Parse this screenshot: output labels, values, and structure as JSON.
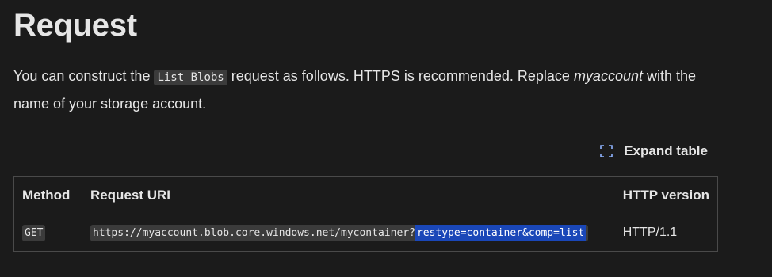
{
  "heading": "Request",
  "intro": {
    "before_code": "You can construct the ",
    "code": "List Blobs",
    "middle": " request as follows. HTTPS is recommended. Replace ",
    "emphasis": "myaccount",
    "after": " with the name of your storage account."
  },
  "expand_table": {
    "label": "Expand table",
    "icon": "expand-icon"
  },
  "table": {
    "headers": [
      "Method",
      "Request URI",
      "HTTP version"
    ],
    "rows": [
      {
        "method": "GET",
        "uri_unselected": "https://myaccount.blob.core.windows.net/mycontainer?",
        "uri_selected": "restype=container&comp=list",
        "http_version": "HTTP/1.1"
      }
    ]
  },
  "colors": {
    "background": "#1b1b1b",
    "text": "#e6e6e6",
    "code_background": "#3b3b3b",
    "selection": "#1a47b8",
    "border": "#4a4a4a",
    "icon_accent": "#8fb4ff"
  }
}
